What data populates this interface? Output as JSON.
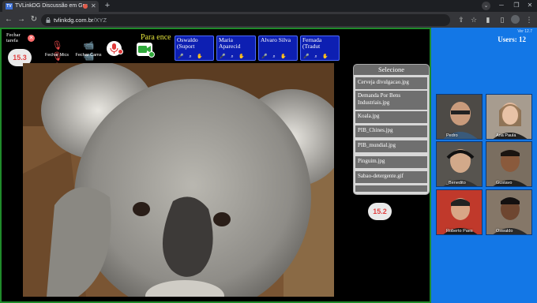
{
  "browser": {
    "tab_title": "TVLinkDG Discussão em Gru",
    "tab_favicon": "TV",
    "url_domain": "tvlinkdg.com.br",
    "url_path": "/XYZ"
  },
  "stage": {
    "close_task_label": "Fechar tarefa",
    "close_mics_label": "Fechar Mics",
    "close_cams_label": "Fechar Cams",
    "badge_top": "15.3",
    "badge_bottom": "15.2",
    "banner_text": "Para ence"
  },
  "user_tiles": [
    {
      "name": "Oswaldo (Suport"
    },
    {
      "name": "Maria Aparecid"
    },
    {
      "name": "Alvaro Silva"
    },
    {
      "name": "Fernada (Tradut"
    }
  ],
  "selector": {
    "title": "Selecione",
    "files": [
      "Cerveja divulgacao.jpg",
      "Demanda Por Bens Industriais.jpg",
      "Koala.jpg",
      "PIB_Chines.jpg",
      "PIB_mundial.jpg",
      "Pinguim.jpg",
      "Sabao-detergente.gif"
    ]
  },
  "sidebar": {
    "version": "Ver 12.7",
    "users_label": "Users: 12",
    "participants": [
      "Pedro",
      "Ana Paula",
      "_Benedito",
      "Gustavo",
      "Roberto Paes",
      "Oswaldo"
    ]
  },
  "colors": {
    "stage_border": "#1f8a2a",
    "sidebar_bg": "#1377e6",
    "user_tile_bg": "#0d1fb2",
    "banner_text": "#e6e63c",
    "badge_text": "#e04040"
  }
}
